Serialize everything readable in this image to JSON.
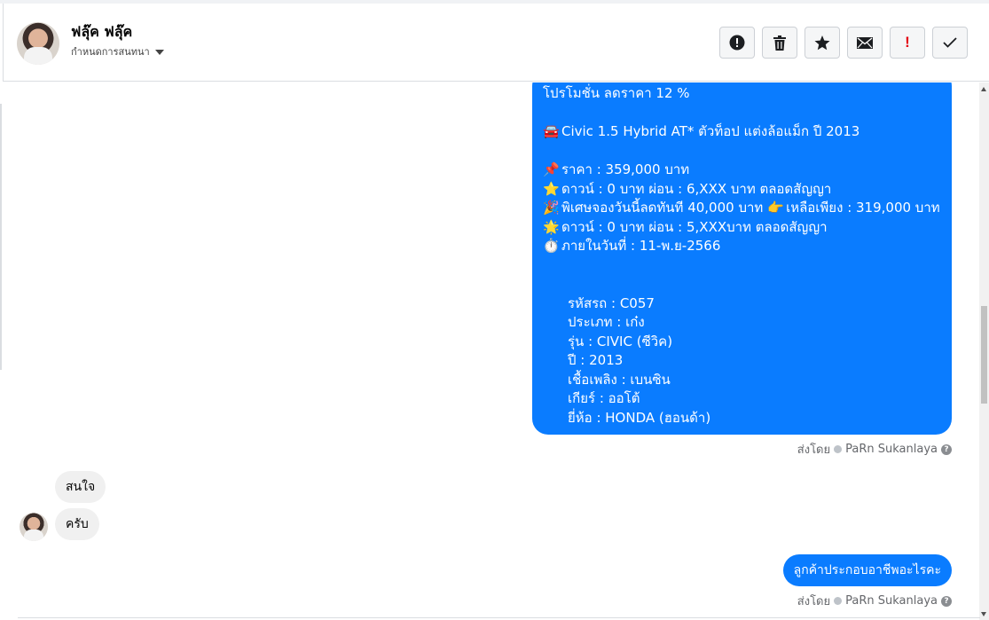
{
  "header": {
    "contact_name": "ฟลุ๊ค ฟลุ๊ค",
    "conversation_settings": "กำหนดการสนทนา",
    "toolbar": [
      {
        "name": "spam-button",
        "icon": "alert-circle-icon"
      },
      {
        "name": "delete-button",
        "icon": "trash-icon"
      },
      {
        "name": "star-button",
        "icon": "star-icon"
      },
      {
        "name": "mark-unread-button",
        "icon": "envelope-icon"
      },
      {
        "name": "important-button",
        "icon": "exclamation-icon",
        "label": "!"
      },
      {
        "name": "done-button",
        "icon": "check-icon"
      }
    ]
  },
  "messages": {
    "promo": {
      "line1": "โปรโมชั่น ลดราคา 12 %",
      "car": {
        "emoji": "🚘",
        "text": "Civic 1.5 Hybrid AT* ตัวท็อป แต่งล้อแม็ก ปี 2013"
      },
      "price": {
        "emoji": "📌",
        "text": "ราคา : 359,000 บาท"
      },
      "down1": {
        "emoji": "⭐",
        "text": "ดาวน์ : 0 บาท ผ่อน : 6,XXX บาท ตลอดสัญญา"
      },
      "special": {
        "emoji": "🎉",
        "text": "พิเศษจองวันนี้ลดทันที 40,000 บาท",
        "emoji2": "👉",
        "text2": "เหลือเพียง : 319,000 บาท"
      },
      "down2": {
        "emoji": "🌟",
        "text": "ดาวน์ : 0 บาท ผ่อน : 5,XXXบาท ตลอดสัญญา"
      },
      "deadline": {
        "emoji": "⏱️",
        "text": "ภายในวันที่ : 11-พ.ย-2566"
      },
      "details": [
        "รหัสรถ : C057",
        "ประเภท : เก๋ง",
        "รุ่น : CIVIC (ซีวิค)",
        "ปี : 2013",
        "เชื้อเพลิง : เบนซิน",
        "เกียร์ : ออโต้",
        "ยี่ห้อ : HONDA (ฮอนด้า)"
      ]
    },
    "sent_by_label": "ส่งโดย",
    "sent_by_name": "PaRn Sukanlaya",
    "incoming": [
      "สนใจ",
      "ครับ"
    ],
    "reply": "ลูกค้าประกอบอาชีพอะไรคะ"
  },
  "colors": {
    "outgoing_bubble": "#0a7cff",
    "incoming_bubble": "#f0f0f0",
    "important": "#e4000f"
  }
}
